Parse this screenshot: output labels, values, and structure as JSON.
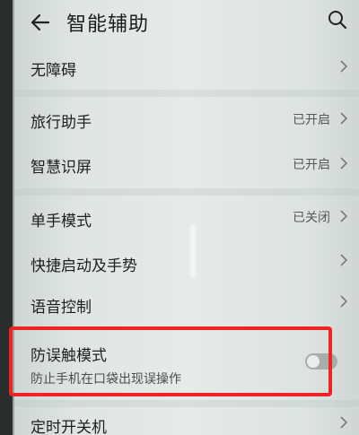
{
  "header": {
    "title": "智能辅助",
    "back_icon": "arrow-left-icon",
    "search_icon": "search-icon"
  },
  "items": [
    {
      "label": "无障碍",
      "value": ""
    },
    {
      "label": "旅行助手",
      "value": "已开启"
    },
    {
      "label": "智慧识屏",
      "value": "已开启"
    },
    {
      "label": "单手模式",
      "value": "已关闭"
    },
    {
      "label": "快捷启动及手势",
      "value": ""
    },
    {
      "label": "语音控制",
      "value": ""
    },
    {
      "label": "防误触模式",
      "subtitle": "防止手机在口袋出现误操作",
      "toggle_on": false
    },
    {
      "label": "定时开关机",
      "value": ""
    }
  ],
  "colors": {
    "highlight": "#ee2323",
    "toggle_off": "#a6adaa"
  }
}
